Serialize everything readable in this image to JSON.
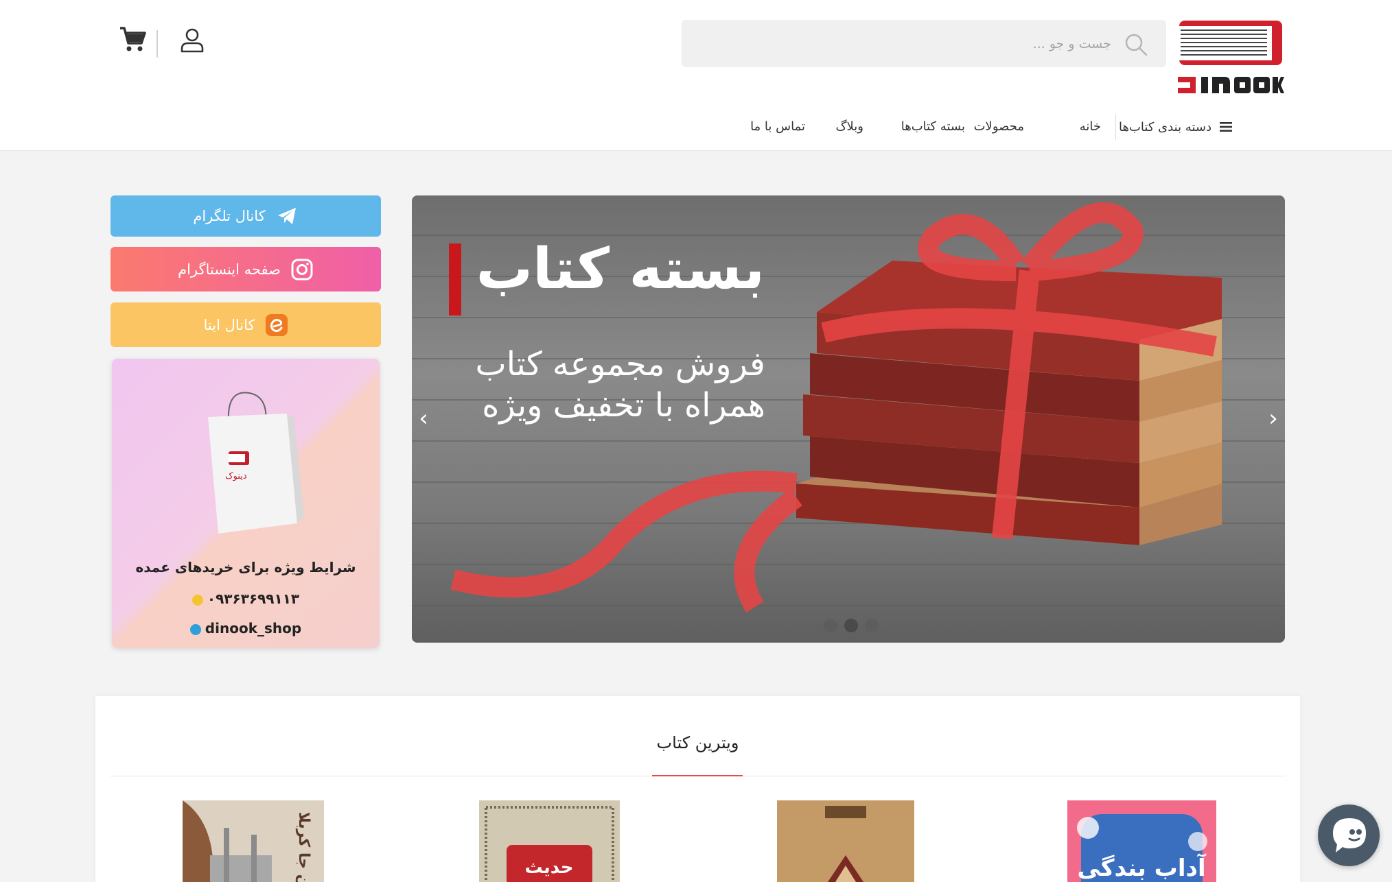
{
  "brand": {
    "name": "dinook",
    "logo_text": "DINOOK",
    "accent_color": "#d0202e"
  },
  "search": {
    "placeholder": "جست و جو ..."
  },
  "nav": {
    "categories_label": "دسته بندی کتاب‌ها",
    "items": [
      "خانه",
      "محصولات",
      "بسته کتاب‌ها",
      "وبلاگ",
      "تماس با ما"
    ]
  },
  "social": {
    "telegram": "کانال تلگرام",
    "instagram": "صفحه اینستاگرام",
    "eitaa": "کانال ایتا"
  },
  "promo": {
    "title": "شرایط ویژه برای خریدهای عمده",
    "phone": "۰۹۳۶۳۶۹۹۱۱۳",
    "handle": "dinook_shop",
    "bag_text": "دینوک"
  },
  "slider": {
    "title": "بسته کتاب",
    "line1": "فروش مجموعه کتاب",
    "line2": "همراه با تخفیف ویژه",
    "slide_count": 3,
    "active_slide": 2
  },
  "showcase": {
    "title": "ویترین کتاب",
    "books": [
      {
        "cover_text": "آداب بندگی",
        "cover_color": "#f15a7a"
      },
      {
        "cover_text": "",
        "cover_color": "#b08a5a"
      },
      {
        "cover_text": "حدیث",
        "cover_color": "#c9c0a8"
      },
      {
        "cover_text": "این جا کربلا",
        "cover_color": "#c9b8a0"
      }
    ]
  },
  "icons": {
    "search": "search-icon",
    "user": "user-icon",
    "cart": "cart-icon",
    "menu": "hamburger-icon",
    "telegram": "telegram-icon",
    "instagram": "instagram-icon",
    "eitaa": "eitaa-icon",
    "chat": "chat-icon"
  }
}
